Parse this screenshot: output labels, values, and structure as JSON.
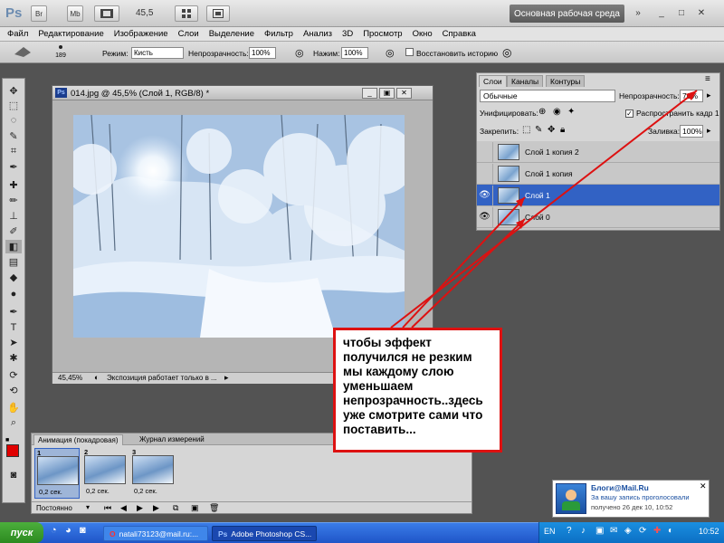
{
  "app": {
    "logo": "Ps",
    "bar_buttons": [
      "Br",
      "Mb"
    ],
    "zoom": "45,5",
    "workspace": "Основная рабочая среда",
    "win_buttons": [
      "»",
      "_",
      "□",
      "✕"
    ]
  },
  "menu": [
    "Файл",
    "Редактирование",
    "Изображение",
    "Слои",
    "Выделение",
    "Фильтр",
    "Анализ",
    "3D",
    "Просмотр",
    "Окно",
    "Справка"
  ],
  "options": {
    "brush_size": "189",
    "mode_label": "Режим:",
    "mode_value": "Кисть",
    "opacity_label": "Непрозрачность:",
    "opacity_value": "100%",
    "press_label": "Нажим:",
    "press_value": "100%",
    "history_label": "Восстановить историю"
  },
  "document": {
    "title": "014.jpg @ 45,5% (Слой 1, RGB/8) *",
    "zoom": "45,45%",
    "status": "Экспозиция работает только в ..."
  },
  "layers": {
    "tabs": [
      "Слои",
      "Каналы",
      "Контуры"
    ],
    "blend_mode": "Обычные",
    "opacity_label": "Непрозрачность:",
    "opacity_value": "70%",
    "unify_label": "Унифицировать:",
    "propagate_label": "Распространить кадр 1",
    "lock_label": "Закрепить:",
    "fill_label": "Заливка:",
    "fill_value": "100%",
    "items": [
      {
        "name": "Слой 1 копия 2",
        "visible": false,
        "selected": false
      },
      {
        "name": "Слой 1 копия",
        "visible": false,
        "selected": false
      },
      {
        "name": "Слой 1",
        "visible": true,
        "selected": true
      },
      {
        "name": "Слой 0",
        "visible": true,
        "selected": false
      }
    ]
  },
  "animation": {
    "tabs": [
      "Анимация (покадровая)",
      "Журнал измерений"
    ],
    "frames": [
      {
        "num": "1",
        "delay": "0,2 сек."
      },
      {
        "num": "2",
        "delay": "0,2 сек."
      },
      {
        "num": "3",
        "delay": "0,2 сек."
      }
    ],
    "loop": "Постоянно"
  },
  "callout": {
    "text": "чтобы эффект получился не резким мы каждому слою уменьшаем непрозрачность..здесь уже смотрите сами что поставить..."
  },
  "notification": {
    "title": "Блоги@Mail.Ru",
    "line1": "За вашу запись проголосовали",
    "line2": "получено 26 дек 10, 10:52"
  },
  "taskbar": {
    "start": "пуск",
    "tasks": [
      "natali73123@mail.ru:...",
      "Adobe Photoshop CS..."
    ],
    "lang": "EN",
    "time": "10:52"
  },
  "colors": {
    "foreground": "#e00000",
    "background": "#ffffff",
    "selection": "#3262c4",
    "callout_border": "#dd1111",
    "arrow": "#dd1111"
  }
}
